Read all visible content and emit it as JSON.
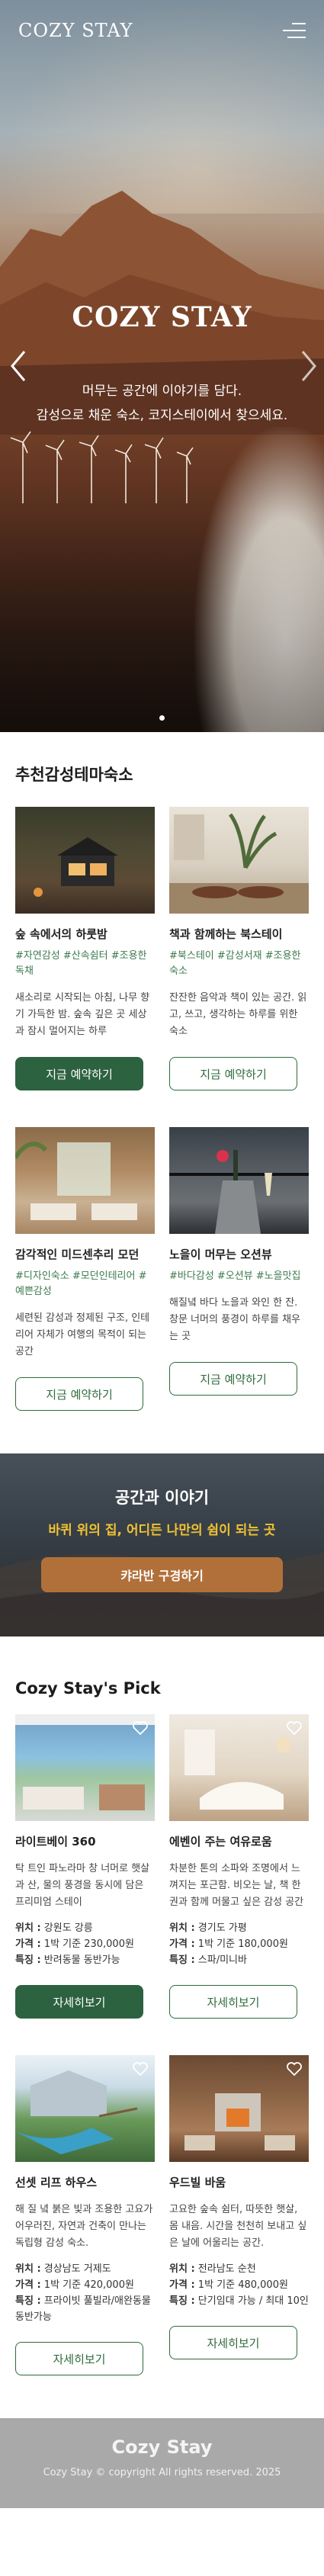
{
  "header": {
    "logo": "COZY STAY"
  },
  "hero": {
    "title": "COZY STAY",
    "subtitle_line1": "머무는 공간에 이야기를 담다.",
    "subtitle_line2": "감성으로 채운 숙소, 코지스테이에서 찾으세요."
  },
  "recommended": {
    "title": "추천감성테마숙소",
    "items": [
      {
        "name": "숲 속에서의 하룻밤",
        "tags": "#자연감성 #산속쉼터 #조용한 독채",
        "desc": "새소리로 시작되는 아침, 나무 향기 가득한 밤. 숲속 깊은 곳 세상과 잠시 멀어지는 하루",
        "button": "지금 예약하기",
        "filled": true
      },
      {
        "name": "책과 함께하는 북스테이",
        "tags": "#북스테이 #감성서재 #조용한숙소",
        "desc": "잔잔한 음악과 책이 있는 공간. 읽고, 쓰고, 생각하는 하루를 위한 숙소",
        "button": "지금 예약하기",
        "filled": false
      },
      {
        "name": "감각적인 미드센추리 모던",
        "tags": "#디자인숙소 #모던인테리어 #예쁜감성",
        "desc": "세련된 감성과 정제된 구조, 인테리어 자체가 여행의 목적이 되는 공간",
        "button": "지금 예약하기",
        "filled": false
      },
      {
        "name": "노을이 머무는 오션뷰",
        "tags": "#바다감성 #오션뷰 #노을맛집",
        "desc": "해질녘 바다 노을과 와인 한 잔. 창문 너머의 풍경이 하루를 채우는 곳",
        "button": "지금 예약하기",
        "filled": false
      }
    ]
  },
  "banner": {
    "title": "공간과 이야기",
    "subtitle": "바퀴 위의 집, 어디든 나만의 쉼이 되는 곳",
    "button": "캬라반 구경하기"
  },
  "pick": {
    "title": "Cozy Stay's Pick",
    "labels": {
      "location": "위치 :",
      "price": "가격 :",
      "feature": "특징 :"
    },
    "items": [
      {
        "name": "라이트베이 360",
        "desc": "탁 트인 파노라마 창 너머로 햇살과 산, 물의 풍경을 동시에 담은 프리미엄 스테이",
        "location": "강원도 강릉",
        "price": "1박 기준 230,000원",
        "feature": "반려동물 동반가능",
        "button": "자세히보기",
        "filled": true
      },
      {
        "name": "에벤이 주는 여유로움",
        "desc": "차분한 톤의 소파와 조명에서 느껴지는 포근함. 비오는 날, 책 한 권과 함께 머물고 싶은 감성 공간",
        "location": "경기도 가평",
        "price": "1박 기준 180,000원",
        "feature": "스파/미니바",
        "button": "자세히보기",
        "filled": false
      },
      {
        "name": "선셋 리프 하우스",
        "desc": "해 질 녘 붉은 빛과 조용한 고요가 어우러진, 자연과 건축이 만나는 독립형 감성 숙소.",
        "location": "경상남도 거제도",
        "price": "1박 기준 420,000원",
        "feature": "프라이빗 풀빌라/애완동물 동반가능",
        "button": "자세히보기",
        "filled": false
      },
      {
        "name": "우드빌 바움",
        "desc": "고요한 숲속 쉼터, 따뜻한 햇살, 몸 내음. 시간을 천천히 보내고 싶은 날에 어울리는 공간.",
        "location": "전라남도 순천",
        "price": "1박 기준 480,000원",
        "feature": "단기임대 가능 / 최대 10인",
        "button": "자세히보기",
        "filled": false
      }
    ]
  },
  "footer": {
    "logo": "Cozy Stay",
    "copyright": "Cozy Stay © copyright All rights reserved. 2025"
  },
  "colors": {
    "accent_green": "#2d6240",
    "tag_green": "#3d7a4f",
    "banner_button": "#b1703a",
    "banner_highlight": "#f1c232",
    "footer_bg": "#a9a9a9"
  }
}
